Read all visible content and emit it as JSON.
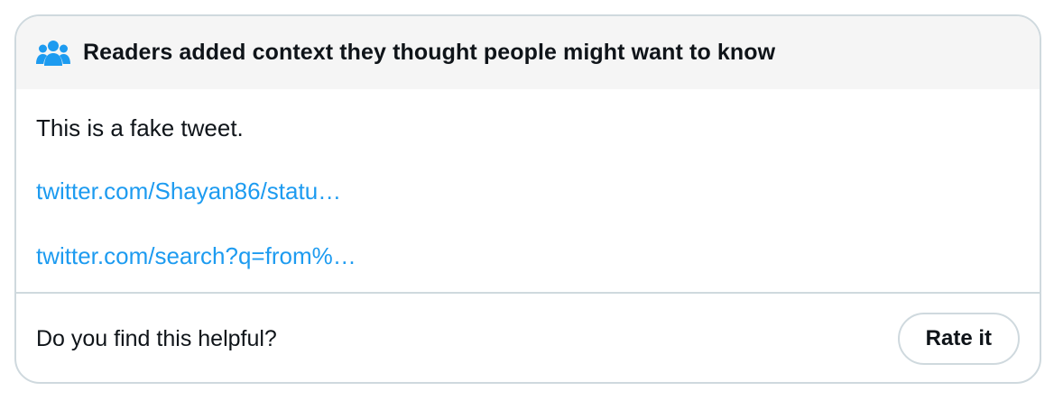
{
  "header": {
    "title": "Readers added context they thought people might want to know",
    "icon": "people-icon",
    "icon_color": "#1d9bf0",
    "background": "#f5f5f5"
  },
  "note": {
    "text": "This is a fake tweet.",
    "links": [
      "twitter.com/Shayan86/statu…",
      "twitter.com/search?q=from%…"
    ],
    "link_color": "#1d9bf0"
  },
  "footer": {
    "question": "Do you find this helpful?",
    "rate_label": "Rate it"
  }
}
